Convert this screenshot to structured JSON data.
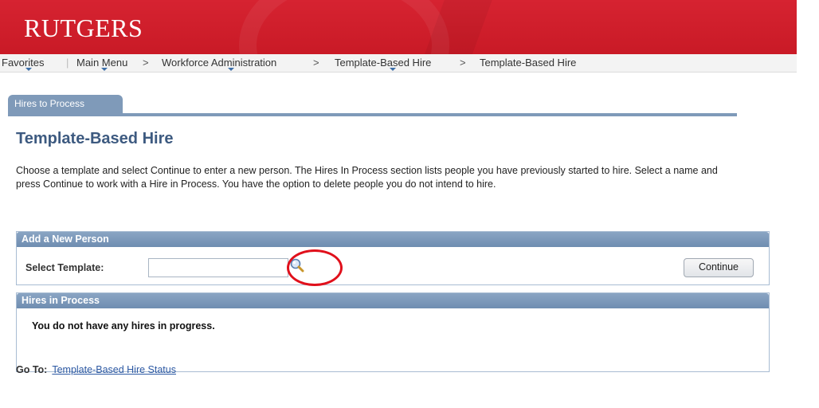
{
  "header": {
    "logo": "RUTGERS"
  },
  "nav": {
    "favorites": "Favorites",
    "main_menu": "Main Menu",
    "sep": ">",
    "workforce": "Workforce Administration",
    "tbh1": "Template-Based Hire",
    "tbh2": "Template-Based Hire"
  },
  "tab": {
    "label": "Hires to Process"
  },
  "page": {
    "title": "Template-Based Hire",
    "description": "Choose a template and select Continue to enter a new person. The Hires In Process section lists people you have previously started to hire. Select a name and press Continue to work with a Hire in Process. You have the option to delete people you do not intend to hire."
  },
  "add_person": {
    "header": "Add a New Person",
    "select_label": "Select Template:",
    "template_value": "",
    "lookup_icon": "magnifier-icon",
    "continue_label": "Continue"
  },
  "hires_in_process": {
    "header": "Hires in Process",
    "message": "You do not have any hires in progress."
  },
  "goto": {
    "label": "Go To:",
    "link": "Template-Based Hire Status"
  },
  "colors": {
    "banner": "#d21f2c",
    "section_header": "#7a97b9",
    "title": "#3d5a80",
    "annotation": "#e0101b"
  }
}
